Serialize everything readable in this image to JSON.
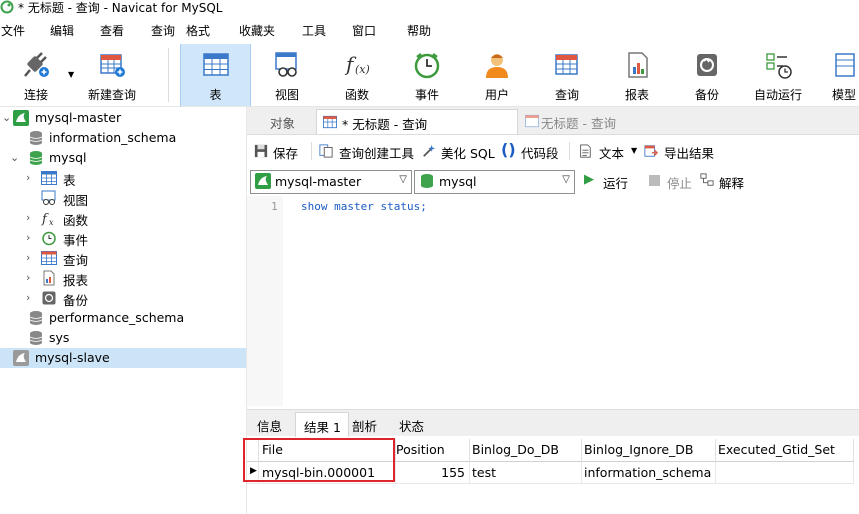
{
  "window": {
    "title": "* 无标题 - 查询 - Navicat for MySQL"
  },
  "menu": [
    "文件",
    "编辑",
    "查看",
    "查询",
    "格式",
    "收藏夹",
    "工具",
    "窗口",
    "帮助"
  ],
  "toolbar": {
    "connect": "连接",
    "new_query": "新建查询",
    "table": "表",
    "view": "视图",
    "function": "函数",
    "event": "事件",
    "user": "用户",
    "query": "查询",
    "report": "报表",
    "backup": "备份",
    "auto_run": "自动运行",
    "model": "模型"
  },
  "tree": {
    "conn1": "mysql-master",
    "db_info": "information_schema",
    "db_mysql": "mysql",
    "tables": "表",
    "views": "视图",
    "functions": "函数",
    "events": "事件",
    "queries": "查询",
    "reports": "报表",
    "backups": "备份",
    "db_perf": "performance_schema",
    "db_sys": "sys",
    "conn2": "mysql-slave"
  },
  "tabs": {
    "objects": "对象",
    "active": "* 无标题 - 查询",
    "inactive": "无标题 - 查询"
  },
  "query_toolbar": {
    "save": "保存",
    "builder": "查询创建工具",
    "beautify": "美化 SQL",
    "snippet": "代码段",
    "text": "文本",
    "export": "导出结果"
  },
  "selectors": {
    "connection": "mysql-master",
    "database": "mysql",
    "run": "运行",
    "stop": "停止",
    "explain": "解释"
  },
  "editor": {
    "line_number": "1",
    "code": "show master status;"
  },
  "result_tabs": [
    "信息",
    "结果 1",
    "剖析",
    "状态"
  ],
  "grid": {
    "columns": [
      "File",
      "Position",
      "Binlog_Do_DB",
      "Binlog_Ignore_DB",
      "Executed_Gtid_Set"
    ],
    "rows": [
      [
        "mysql-bin.000001",
        "155",
        "test",
        "information_schema",
        ""
      ]
    ]
  },
  "colors": {
    "accent": "#1b5dc4",
    "selected": "#cce4f7",
    "highlight_box": "#e0242b"
  }
}
